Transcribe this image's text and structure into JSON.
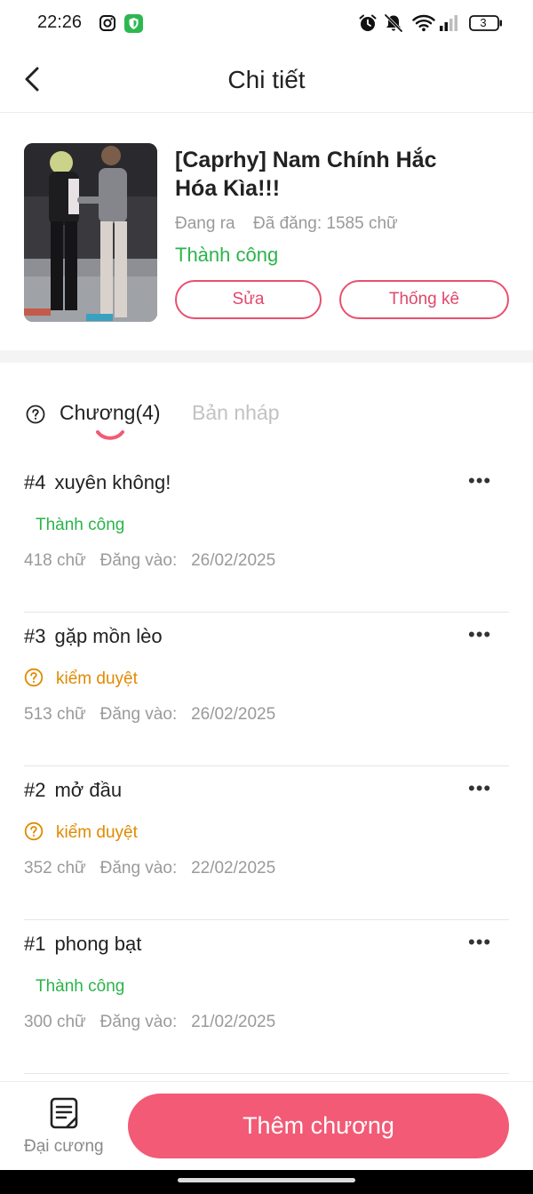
{
  "status_bar": {
    "time": "22:26",
    "battery_level": "3",
    "icons": [
      "instagram-icon",
      "shield-icon",
      "alarm-icon",
      "bell-off-icon",
      "wifi-icon",
      "signal-icon",
      "battery-icon"
    ]
  },
  "header": {
    "title": "Chi tiết",
    "back_icon": "chevron-left-icon"
  },
  "book": {
    "title": "[Caprhy] Nam Chính Hắc Hóa Kìa!!!",
    "publish_state": "Đang ra",
    "word_count_text": "Đã đăng: 1585 chữ",
    "review_status": "Thành công",
    "edit_label": "Sửa",
    "stats_label": "Thống kê"
  },
  "tabs": {
    "chapters_label": "Chương(4)",
    "drafts_label": "Bản nháp",
    "help_icon": "question-circle-icon"
  },
  "chapters": [
    {
      "number": "#4",
      "title": "xuyên không!",
      "status": "Thành công",
      "status_type": "success",
      "words": "418 chữ",
      "date_label": "Đăng vào:",
      "date": "26/02/2025"
    },
    {
      "number": "#3",
      "title": "gặp mồn lèo",
      "status": "kiểm duyệt",
      "status_type": "review",
      "words": "513 chữ",
      "date_label": "Đăng vào:",
      "date": "26/02/2025"
    },
    {
      "number": "#2",
      "title": "mở đầu",
      "status": "kiểm duyệt",
      "status_type": "review",
      "words": "352 chữ",
      "date_label": "Đăng vào:",
      "date": "22/02/2025"
    },
    {
      "number": "#1",
      "title": "phong bạt",
      "status": "Thành công",
      "status_type": "success",
      "words": "300 chữ",
      "date_label": "Đăng vào:",
      "date": "21/02/2025"
    }
  ],
  "bottom": {
    "outline_label": "Đại cương",
    "outline_icon": "document-list-icon",
    "add_chapter_label": "Thêm chương"
  },
  "colors": {
    "accent": "#f25a76",
    "success": "#2bb44a",
    "review": "#e08a00"
  }
}
